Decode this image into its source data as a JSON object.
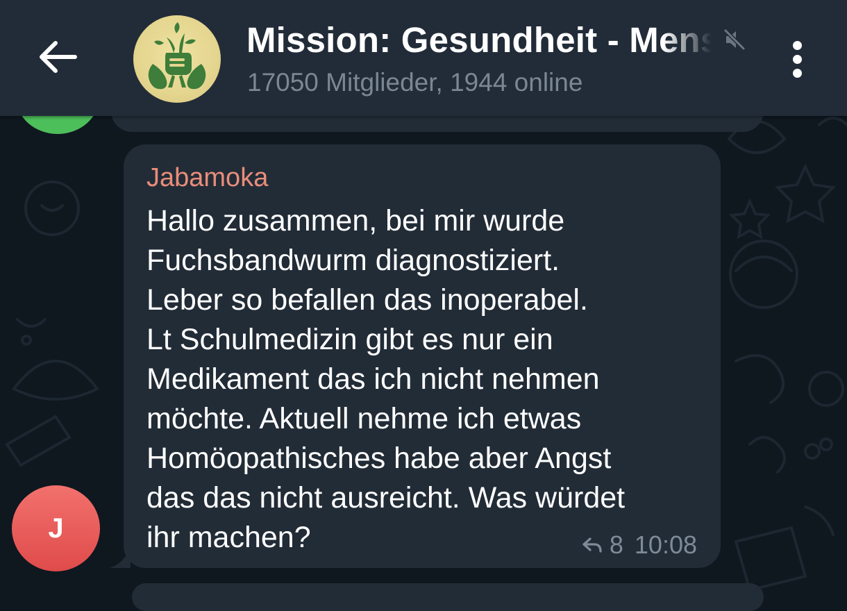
{
  "header": {
    "back_icon": "arrow-left-icon",
    "title": "Mission: Gesundheit - Mens",
    "muted_icon": "speaker-muted-icon",
    "subtitle": "17050 Mitglieder, 1944 online",
    "menu_icon": "more-vertical-icon"
  },
  "message": {
    "sender": "Jabamoka",
    "sender_color": "#e98d7a",
    "text": "Hallo zusammen,  bei mir wurde\nFuchsbandwurm diagnostiziert.\nLeber so befallen das inoperabel.\nLt Schulmedizin gibt es nur ein\nMedikament das ich nicht nehmen\nmöchte.  Aktuell nehme ich etwas\nHomöopathisches habe aber Angst\ndas das nicht ausreicht.  Was würdet\nihr machen?",
    "reply_icon": "reply-arrow-icon",
    "reply_count": "8",
    "time": "10:08",
    "avatar_initial": "J"
  },
  "colors": {
    "header_bg": "#222c38",
    "chat_bg": "#0f171f",
    "bubble_bg": "#222c37",
    "avatar_red": "#e55353",
    "avatar_green": "#4cbe5a"
  }
}
